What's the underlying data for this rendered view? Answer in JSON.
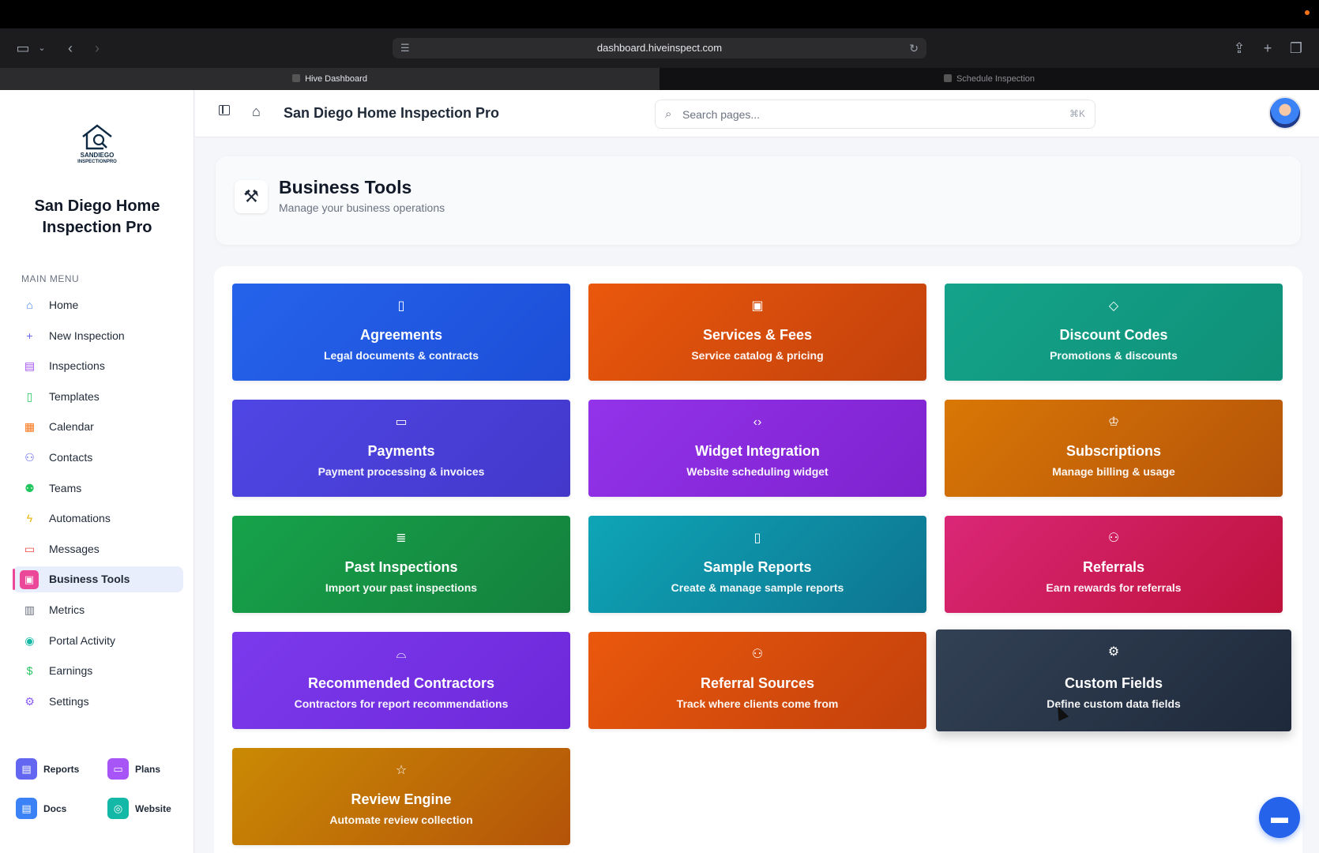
{
  "browser": {
    "url": "dashboard.hiveinspect.com",
    "tabs": [
      {
        "label": "Hive Dashboard",
        "active": true
      },
      {
        "label": "Schedule Inspection",
        "active": false
      }
    ]
  },
  "sidebar": {
    "logo_text_1": "SANDIEGO",
    "logo_text_2": "INSPECTIONPRO",
    "brand_line1": "San Diego Home",
    "brand_line2": "Inspection Pro",
    "menu_heading": "MAIN MENU",
    "items": [
      {
        "label": "Home",
        "icon": "home-icon",
        "color": "#3b82f6"
      },
      {
        "label": "New Inspection",
        "icon": "plus-icon",
        "color": "#6366f1"
      },
      {
        "label": "Inspections",
        "icon": "clipboard-icon",
        "color": "#a855f7"
      },
      {
        "label": "Templates",
        "icon": "document-icon",
        "color": "#22c55e"
      },
      {
        "label": "Calendar",
        "icon": "calendar-icon",
        "color": "#f97316"
      },
      {
        "label": "Contacts",
        "icon": "users-icon",
        "color": "#6366f1"
      },
      {
        "label": "Teams",
        "icon": "team-icon",
        "color": "#22c55e"
      },
      {
        "label": "Automations",
        "icon": "lightning-icon",
        "color": "#eab308"
      },
      {
        "label": "Messages",
        "icon": "chat-icon",
        "color": "#ef4444"
      },
      {
        "label": "Business Tools",
        "icon": "briefcase-icon",
        "color": "#ec4899",
        "active": true
      },
      {
        "label": "Metrics",
        "icon": "bar-chart-icon",
        "color": "#6b7280"
      },
      {
        "label": "Portal Activity",
        "icon": "eye-icon",
        "color": "#14b8a6"
      },
      {
        "label": "Earnings",
        "icon": "dollar-icon",
        "color": "#22c55e"
      },
      {
        "label": "Settings",
        "icon": "gear-icon",
        "color": "#8b5cf6"
      }
    ],
    "bottom_links": [
      {
        "label": "Reports",
        "color": "#6366f1"
      },
      {
        "label": "Plans",
        "color": "#a855f7"
      },
      {
        "label": "Docs",
        "color": "#3b82f6"
      },
      {
        "label": "Website",
        "color": "#14b8a6"
      }
    ]
  },
  "header": {
    "title": "San Diego Home Inspection Pro",
    "search_placeholder": "Search pages...",
    "shortcut": "⌘K"
  },
  "page": {
    "title": "Business Tools",
    "subtitle": "Manage your business operations"
  },
  "cards": [
    {
      "title": "Agreements",
      "subtitle": "Legal documents & contracts",
      "icon": "document-icon",
      "color_from": "#2563eb",
      "color_to": "#1d4ed8"
    },
    {
      "title": "Services & Fees",
      "subtitle": "Service catalog & pricing",
      "icon": "briefcase-icon",
      "color_from": "#ea580c",
      "color_to": "#c2410c"
    },
    {
      "title": "Discount Codes",
      "subtitle": "Promotions & discounts",
      "icon": "tag-icon",
      "color_from": "#14a38b",
      "color_to": "#0f9077"
    },
    {
      "title": "Payments",
      "subtitle": "Payment processing & invoices",
      "icon": "card-icon",
      "color_from": "#4f46e5",
      "color_to": "#4338ca"
    },
    {
      "title": "Widget Integration",
      "subtitle": "Website scheduling widget",
      "icon": "code-icon",
      "color_from": "#9333ea",
      "color_to": "#7e22ce"
    },
    {
      "title": "Subscriptions",
      "subtitle": "Manage billing & usage",
      "icon": "crown-icon",
      "color_from": "#d97706",
      "color_to": "#b45309"
    },
    {
      "title": "Past Inspections",
      "subtitle": "Import your past inspections",
      "icon": "database-icon",
      "color_from": "#16a34a",
      "color_to": "#15803d"
    },
    {
      "title": "Sample Reports",
      "subtitle": "Create & manage sample reports",
      "icon": "file-icon",
      "color_from": "#0ea5b7",
      "color_to": "#0e7490"
    },
    {
      "title": "Referrals",
      "subtitle": "Earn rewards for referrals",
      "icon": "users-icon",
      "color_from": "#db2777",
      "color_to": "#be123c"
    },
    {
      "title": "Recommended Contractors",
      "subtitle": "Contractors for report recommendations",
      "icon": "hardhat-icon",
      "color_from": "#7c3aed",
      "color_to": "#6d28d9"
    },
    {
      "title": "Referral Sources",
      "subtitle": "Track where clients come from",
      "icon": "users-icon",
      "color_from": "#ea580c",
      "color_to": "#c2410c"
    },
    {
      "title": "Custom Fields",
      "subtitle": "Define custom data fields",
      "icon": "gear-icon",
      "color_from": "#334155",
      "color_to": "#1e293b"
    },
    {
      "title": "Review Engine",
      "subtitle": "Automate review collection",
      "icon": "star-icon",
      "color_from": "#ca8a04",
      "color_to": "#b45309"
    }
  ]
}
